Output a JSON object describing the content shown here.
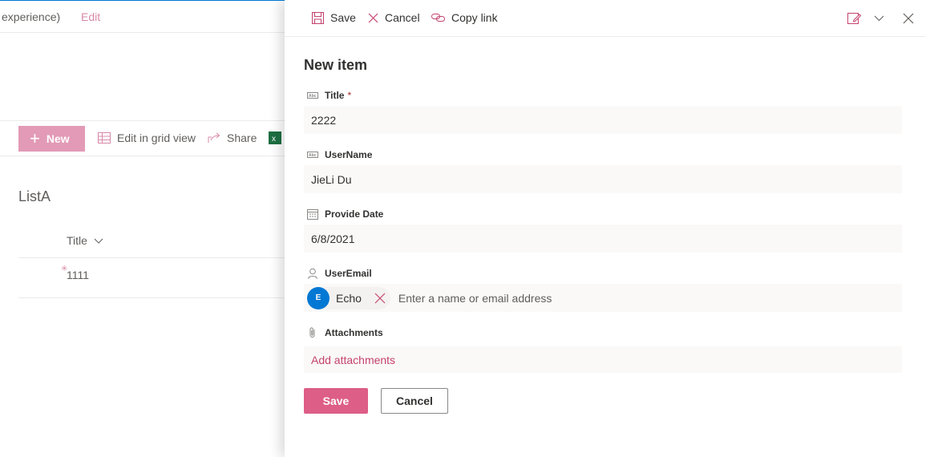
{
  "background": {
    "breadcrumb_fragment": "experience)",
    "edit_link": "Edit",
    "commands": {
      "new_label": "New",
      "edit_grid_label": "Edit in grid view",
      "share_label": "Share"
    },
    "list_title": "ListA",
    "column_header": "Title",
    "rows": [
      "1111"
    ]
  },
  "panel": {
    "toolbar": {
      "save_label": "Save",
      "cancel_label": "Cancel",
      "copy_link_label": "Copy link"
    },
    "title": "New item",
    "fields": {
      "title": {
        "label": "Title",
        "required_mark": "*",
        "value": "2222"
      },
      "username": {
        "label": "UserName",
        "value": "JieLi Du"
      },
      "provide_date": {
        "label": "Provide Date",
        "value": "6/8/2021"
      },
      "useremail": {
        "label": "UserEmail",
        "persona_initial": "E",
        "persona_name": "Echo",
        "placeholder": "Enter a name or email address"
      },
      "attachments": {
        "label": "Attachments",
        "link": "Add attachments"
      }
    },
    "footer": {
      "save_label": "Save",
      "cancel_label": "Cancel"
    }
  },
  "colors": {
    "accent": "#dd5e87",
    "link": "#c5426e",
    "avatar": "#0078d4"
  }
}
